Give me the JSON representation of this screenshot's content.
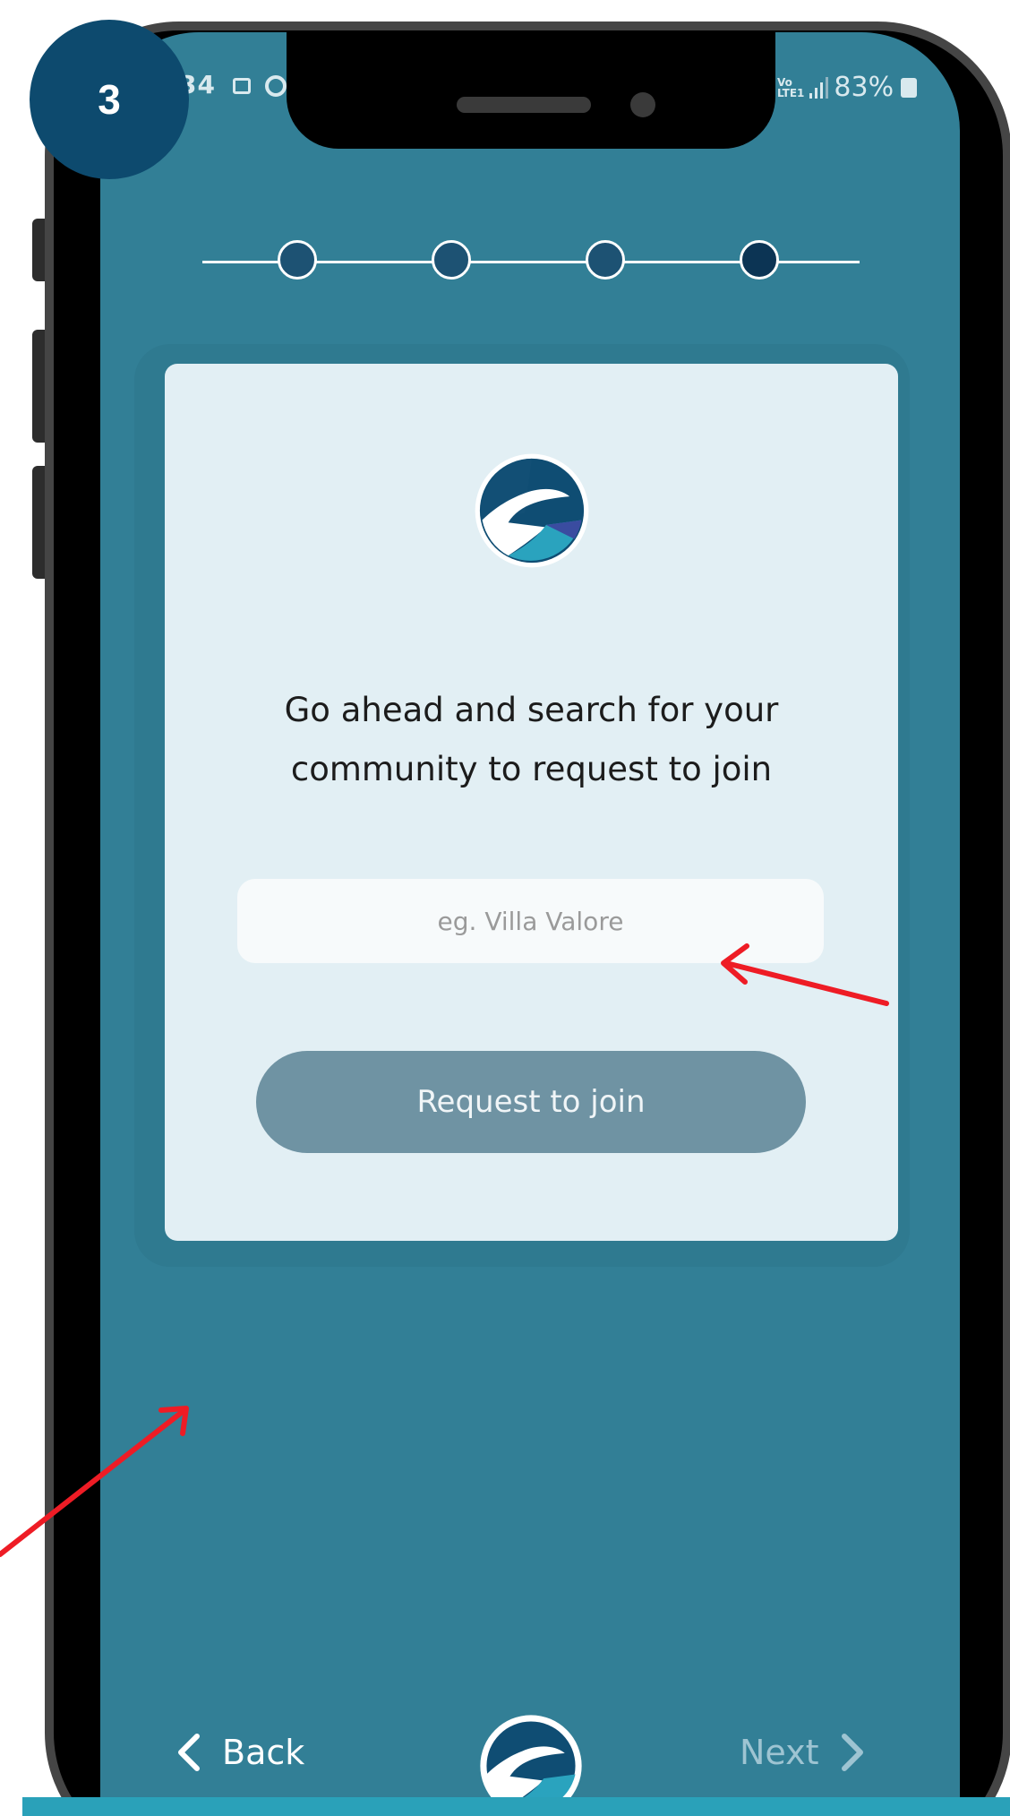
{
  "step_badge": "3",
  "status_bar": {
    "left_text": "34",
    "network_top": "Vo",
    "network_bottom": "LTE1",
    "battery": "83%"
  },
  "stepper": {
    "total_steps": 4
  },
  "card": {
    "prompt": "Go ahead and search for your community to request to join",
    "search_placeholder": "eg. Villa Valore",
    "join_button_label": "Request to join"
  },
  "nav": {
    "back_label": "Back",
    "next_label": "Next"
  },
  "colors": {
    "screen_bg": "#327f96",
    "card_bg": "#e2eff4",
    "badge_bg": "#0d4a6e",
    "button_bg": "#6f93a3",
    "annotation": "#ee1c25"
  },
  "icons": {
    "back": "chevron-left-icon",
    "next": "chevron-right-icon",
    "logo": "app-logo"
  }
}
